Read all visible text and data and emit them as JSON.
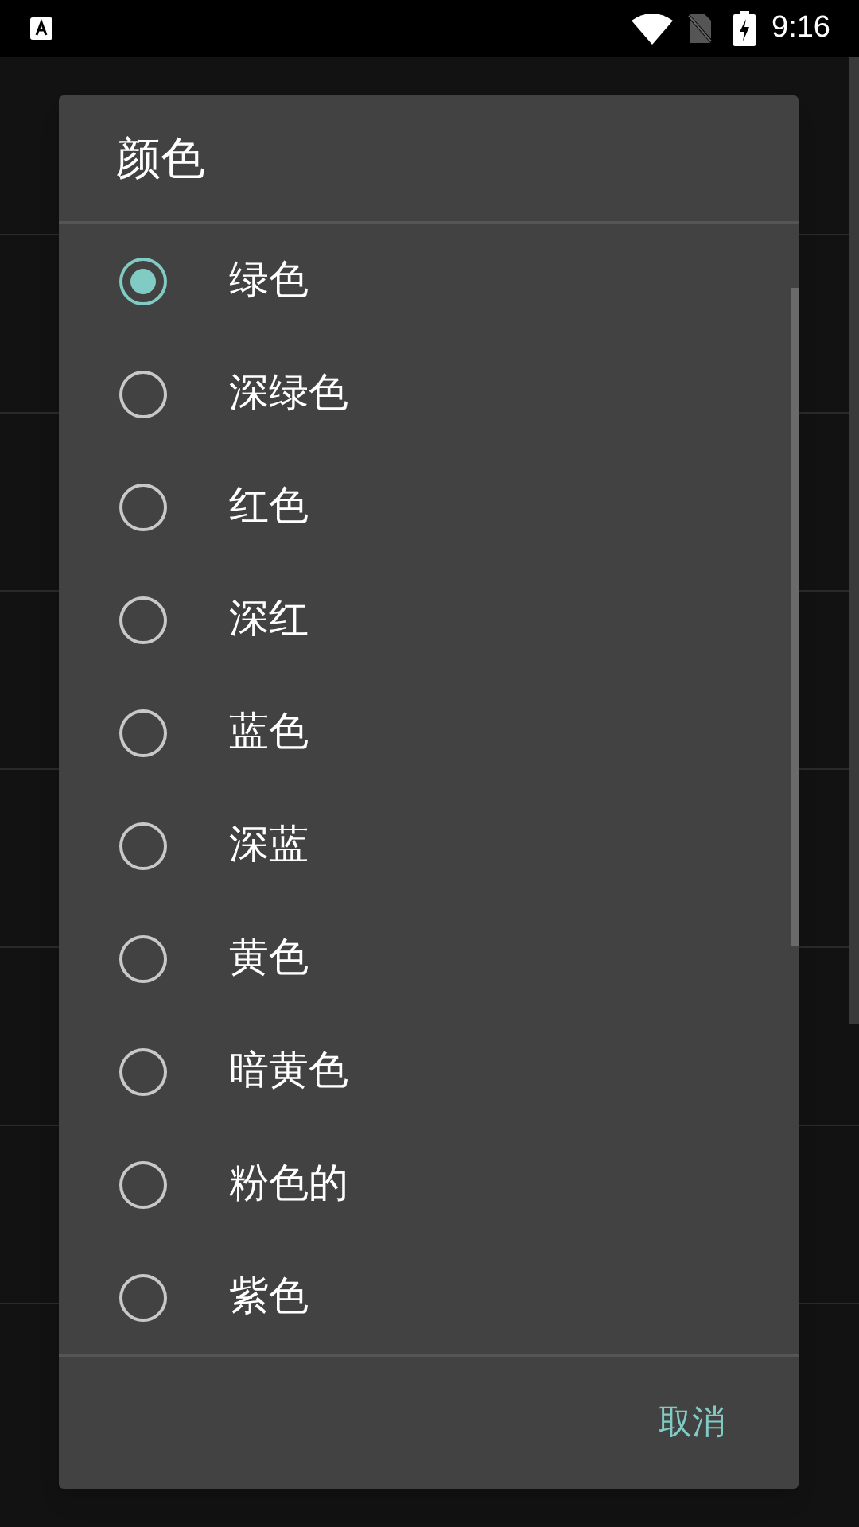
{
  "status_bar": {
    "time": "9:16"
  },
  "dialog": {
    "title": "颜色",
    "options": [
      {
        "label": "绿色",
        "selected": true
      },
      {
        "label": "深绿色",
        "selected": false
      },
      {
        "label": "红色",
        "selected": false
      },
      {
        "label": "深红",
        "selected": false
      },
      {
        "label": "蓝色",
        "selected": false
      },
      {
        "label": "深蓝",
        "selected": false
      },
      {
        "label": "黄色",
        "selected": false
      },
      {
        "label": "暗黄色",
        "selected": false
      },
      {
        "label": "粉色的",
        "selected": false
      },
      {
        "label": "紫色",
        "selected": false
      }
    ],
    "cancel_button": "取消"
  }
}
